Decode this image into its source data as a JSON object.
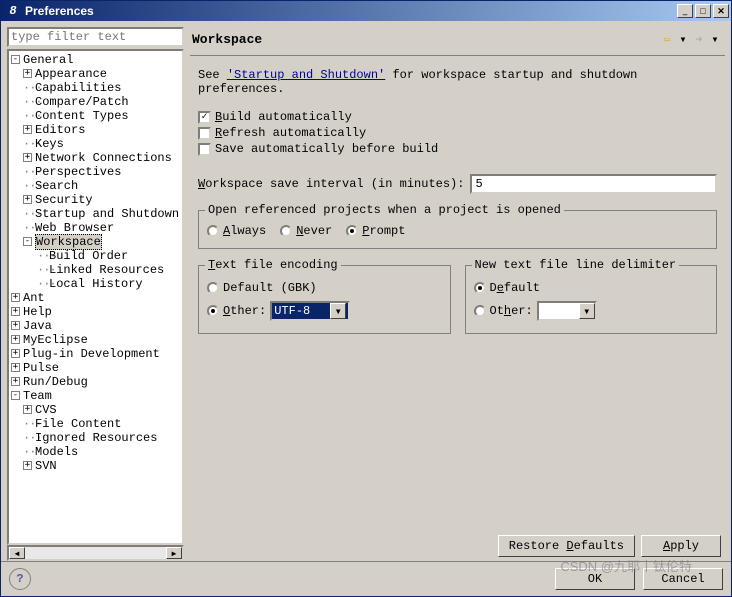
{
  "window": {
    "title": "Preferences"
  },
  "filter": {
    "placeholder": "type filter text"
  },
  "tree": {
    "general": {
      "label": "General",
      "children": [
        "Appearance",
        "Capabilities",
        "Compare/Patch",
        "Content Types",
        "Editors",
        "Keys",
        "Network Connections",
        "Perspectives",
        "Search",
        "Security",
        "Startup and Shutdown",
        "Web Browser"
      ]
    },
    "workspace": {
      "label": "Workspace",
      "children": [
        "Build Order",
        "Linked Resources",
        "Local History"
      ]
    },
    "rest": [
      "Ant",
      "Help",
      "Java",
      "MyEclipse",
      "Plug-in Development",
      "Pulse",
      "Run/Debug"
    ],
    "team": {
      "label": "Team",
      "children": [
        "CVS",
        "File Content",
        "Ignored Resources",
        "Models",
        "SVN"
      ]
    }
  },
  "page": {
    "title": "Workspace",
    "desc_prefix": "See ",
    "link": "'Startup and Shutdown'",
    "desc_suffix": " for workspace startup and shutdown preferences.",
    "build_auto": "Build automatically",
    "refresh_auto": "Refresh automatically",
    "save_before": "Save automatically before build",
    "interval_label": "Workspace save interval (in minutes):",
    "interval_value": "5",
    "open_ref_title": "Open referenced projects when a project is opened",
    "opt_always": "Always",
    "opt_never": "Never",
    "opt_prompt": "Prompt",
    "enc_title": "Text file encoding",
    "enc_default": "Default (GBK)",
    "enc_other": "Other:",
    "enc_value": "UTF-8",
    "delim_title": "New text file line delimiter",
    "delim_default": "Default",
    "delim_other": "Other:"
  },
  "buttons": {
    "restore": "Restore Defaults",
    "apply": "Apply",
    "ok": "OK",
    "cancel": "Cancel"
  },
  "watermark": "CSDN @九耶丨钛伦特"
}
